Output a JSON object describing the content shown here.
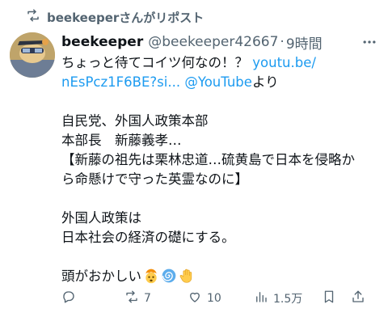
{
  "repost": {
    "label": "beekeeperさんがリポスト"
  },
  "post": {
    "display_name": "beekeeper",
    "handle": "@beekeeper42667",
    "separator": "·",
    "time": "9時間",
    "lines": [
      {
        "parts": [
          {
            "t": "ちょっと待てコイツ何なの！？ ",
            "link": false
          },
          {
            "t": "youtu.be/",
            "link": true
          }
        ]
      },
      {
        "parts": [
          {
            "t": "nEsPcz1F6BE?si...",
            "link": true
          },
          {
            "t": " ",
            "link": false
          },
          {
            "t": "@YouTube",
            "link": true
          },
          {
            "t": "より",
            "link": false
          }
        ]
      },
      {
        "gap": true
      },
      {
        "parts": [
          {
            "t": "自民党、外国人政策本部",
            "link": false
          }
        ]
      },
      {
        "parts": [
          {
            "t": "本部長　新藤義孝…",
            "link": false
          }
        ]
      },
      {
        "parts": [
          {
            "t": "【新藤の祖先は栗林忠道…硫黄島で日本を侵略か",
            "link": false
          }
        ]
      },
      {
        "parts": [
          {
            "t": "ら命懸けで守った英霊なのに】",
            "link": false
          }
        ]
      },
      {
        "gap": true
      },
      {
        "parts": [
          {
            "t": "外国人政策は",
            "link": false
          }
        ]
      },
      {
        "parts": [
          {
            "t": "日本社会の経済の礎にする。",
            "link": false
          }
        ]
      },
      {
        "gap": true
      },
      {
        "parts": [
          {
            "t": "頭がおかしい",
            "link": false
          }
        ],
        "emojis": [
          "exploding-head",
          "dizzy-spiral",
          "raised-hand"
        ]
      }
    ]
  },
  "actions": {
    "reply_count": "",
    "repost_count": "7",
    "like_count": "10",
    "views_count": "1.5万"
  }
}
